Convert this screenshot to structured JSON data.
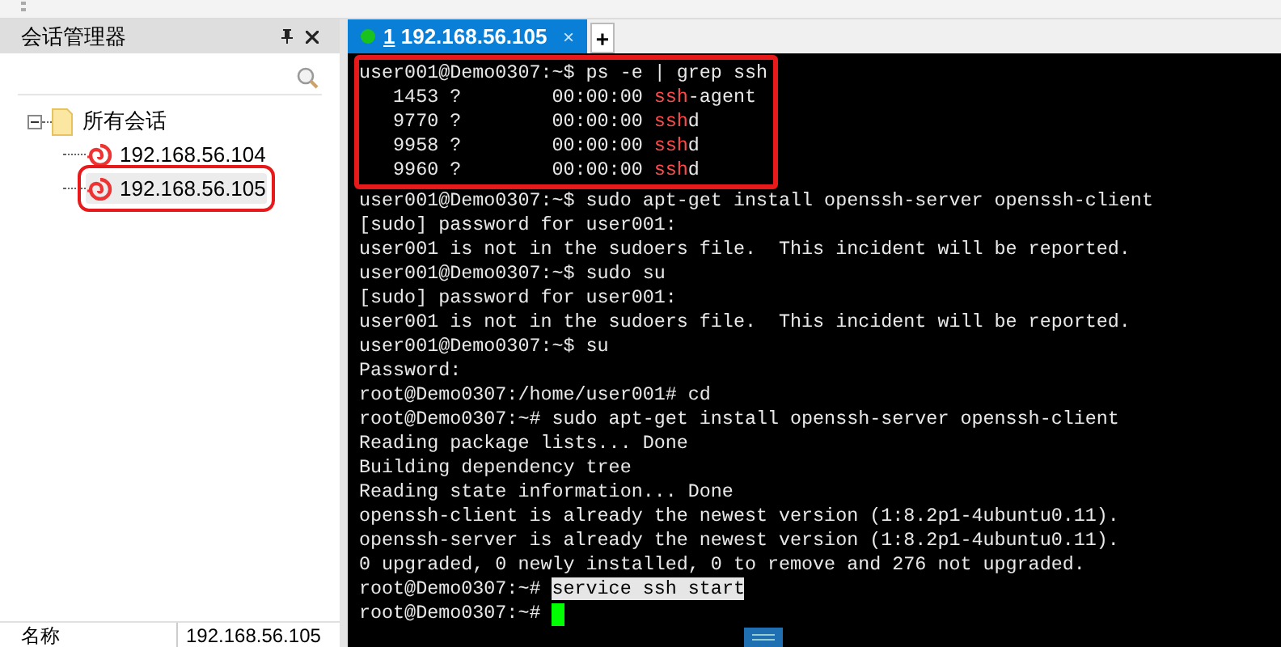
{
  "session_panel": {
    "title": "会话管理器",
    "tree": [
      {
        "label": "所有会话",
        "expanded": true,
        "children": [
          {
            "label": "192.168.56.104",
            "selected": false,
            "highlighted": false
          },
          {
            "label": "192.168.56.105",
            "selected": true,
            "highlighted": true
          }
        ]
      }
    ],
    "properties": [
      {
        "name": "名称",
        "value": "192.168.56.105"
      }
    ]
  },
  "tabs": [
    {
      "number": "1",
      "label": "192.168.56.105",
      "selected": true,
      "connected": true,
      "close": "×"
    }
  ],
  "new_tab": "+",
  "terminal": {
    "blocks": [
      {
        "highlighted": true,
        "lines": [
          [
            {
              "kind": "plain",
              "text": "user001@Demo0307:~$ ps -e | grep ssh"
            }
          ],
          [
            {
              "kind": "plain",
              "text": "   1453 ?        00:00:00 "
            },
            {
              "kind": "match",
              "text": "ssh"
            },
            {
              "kind": "plain",
              "text": "-agent"
            }
          ],
          [
            {
              "kind": "plain",
              "text": "   9770 ?        00:00:00 "
            },
            {
              "kind": "match",
              "text": "ssh"
            },
            {
              "kind": "plain",
              "text": "d"
            }
          ],
          [
            {
              "kind": "plain",
              "text": "   9958 ?        00:00:00 "
            },
            {
              "kind": "match",
              "text": "ssh"
            },
            {
              "kind": "plain",
              "text": "d"
            }
          ],
          [
            {
              "kind": "plain",
              "text": "   9960 ?        00:00:00 "
            },
            {
              "kind": "match",
              "text": "ssh"
            },
            {
              "kind": "plain",
              "text": "d"
            }
          ]
        ]
      },
      {
        "highlighted": false,
        "lines": [
          [
            {
              "kind": "plain",
              "text": "user001@Demo0307:~$ sudo apt-get install openssh-server openssh-client"
            }
          ],
          [
            {
              "kind": "plain",
              "text": "[sudo] password for user001:"
            }
          ],
          [
            {
              "kind": "plain",
              "text": "user001 is not in the sudoers file.  This incident will be reported."
            }
          ],
          [
            {
              "kind": "plain",
              "text": "user001@Demo0307:~$ sudo su"
            }
          ],
          [
            {
              "kind": "plain",
              "text": "[sudo] password for user001:"
            }
          ],
          [
            {
              "kind": "plain",
              "text": "user001 is not in the sudoers file.  This incident will be reported."
            }
          ],
          [
            {
              "kind": "plain",
              "text": "user001@Demo0307:~$ su"
            }
          ],
          [
            {
              "kind": "plain",
              "text": "Password:"
            }
          ],
          [
            {
              "kind": "plain",
              "text": "root@Demo0307:/home/user001# cd"
            }
          ],
          [
            {
              "kind": "plain",
              "text": "root@Demo0307:~# sudo apt-get install openssh-server openssh-client"
            }
          ],
          [
            {
              "kind": "plain",
              "text": "Reading package lists... Done"
            }
          ],
          [
            {
              "kind": "plain",
              "text": "Building dependency tree"
            }
          ],
          [
            {
              "kind": "plain",
              "text": "Reading state information... Done"
            }
          ],
          [
            {
              "kind": "plain",
              "text": "openssh-client is already the newest version (1:8.2p1-4ubuntu0.11)."
            }
          ],
          [
            {
              "kind": "plain",
              "text": "openssh-server is already the newest version (1:8.2p1-4ubuntu0.11)."
            }
          ],
          [
            {
              "kind": "plain",
              "text": "0 upgraded, 0 newly installed, 0 to remove and 276 not upgraded."
            }
          ],
          [
            {
              "kind": "plain",
              "text": "root@Demo0307:~# "
            },
            {
              "kind": "selection",
              "text": "service ssh start"
            }
          ],
          [
            {
              "kind": "plain",
              "text": "root@Demo0307:~# "
            },
            {
              "kind": "cursor"
            }
          ]
        ]
      }
    ]
  }
}
